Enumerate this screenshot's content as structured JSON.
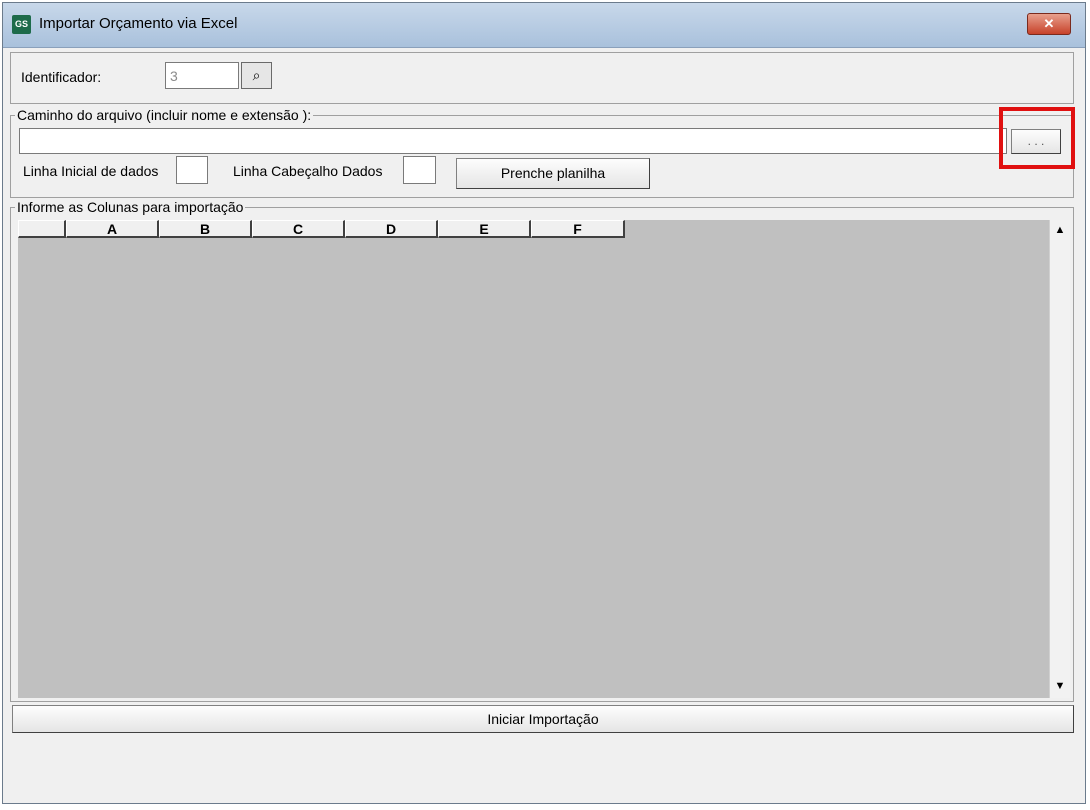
{
  "window": {
    "title": "Importar Orçamento via Excel",
    "app_icon_text": "GS",
    "close_label": "✕"
  },
  "identificador": {
    "label": "Identificador:",
    "value": "3",
    "search_icon": "binoculars-icon",
    "search_glyph": "⌕"
  },
  "arquivo": {
    "legend": "Caminho do arquivo (incluir nome e extensão ):",
    "path_value": "",
    "browse_label": ". . .",
    "linha_inicial_label": "Linha Inicial de dados",
    "linha_inicial_value": "",
    "linha_cabecalho_label": "Linha Cabeçalho Dados",
    "linha_cabecalho_value": "",
    "preenche_label": "Prenche planilha"
  },
  "colunas": {
    "legend": "Informe as Colunas para importação",
    "headers": [
      "",
      "A",
      "B",
      "C",
      "D",
      "E",
      "F"
    ],
    "scroll_up_glyph": "▲",
    "scroll_down_glyph": "▼"
  },
  "footer": {
    "import_label": "Iniciar Importação"
  },
  "colors": {
    "highlight": "#e01010",
    "grid_background": "#c0c0c0"
  }
}
